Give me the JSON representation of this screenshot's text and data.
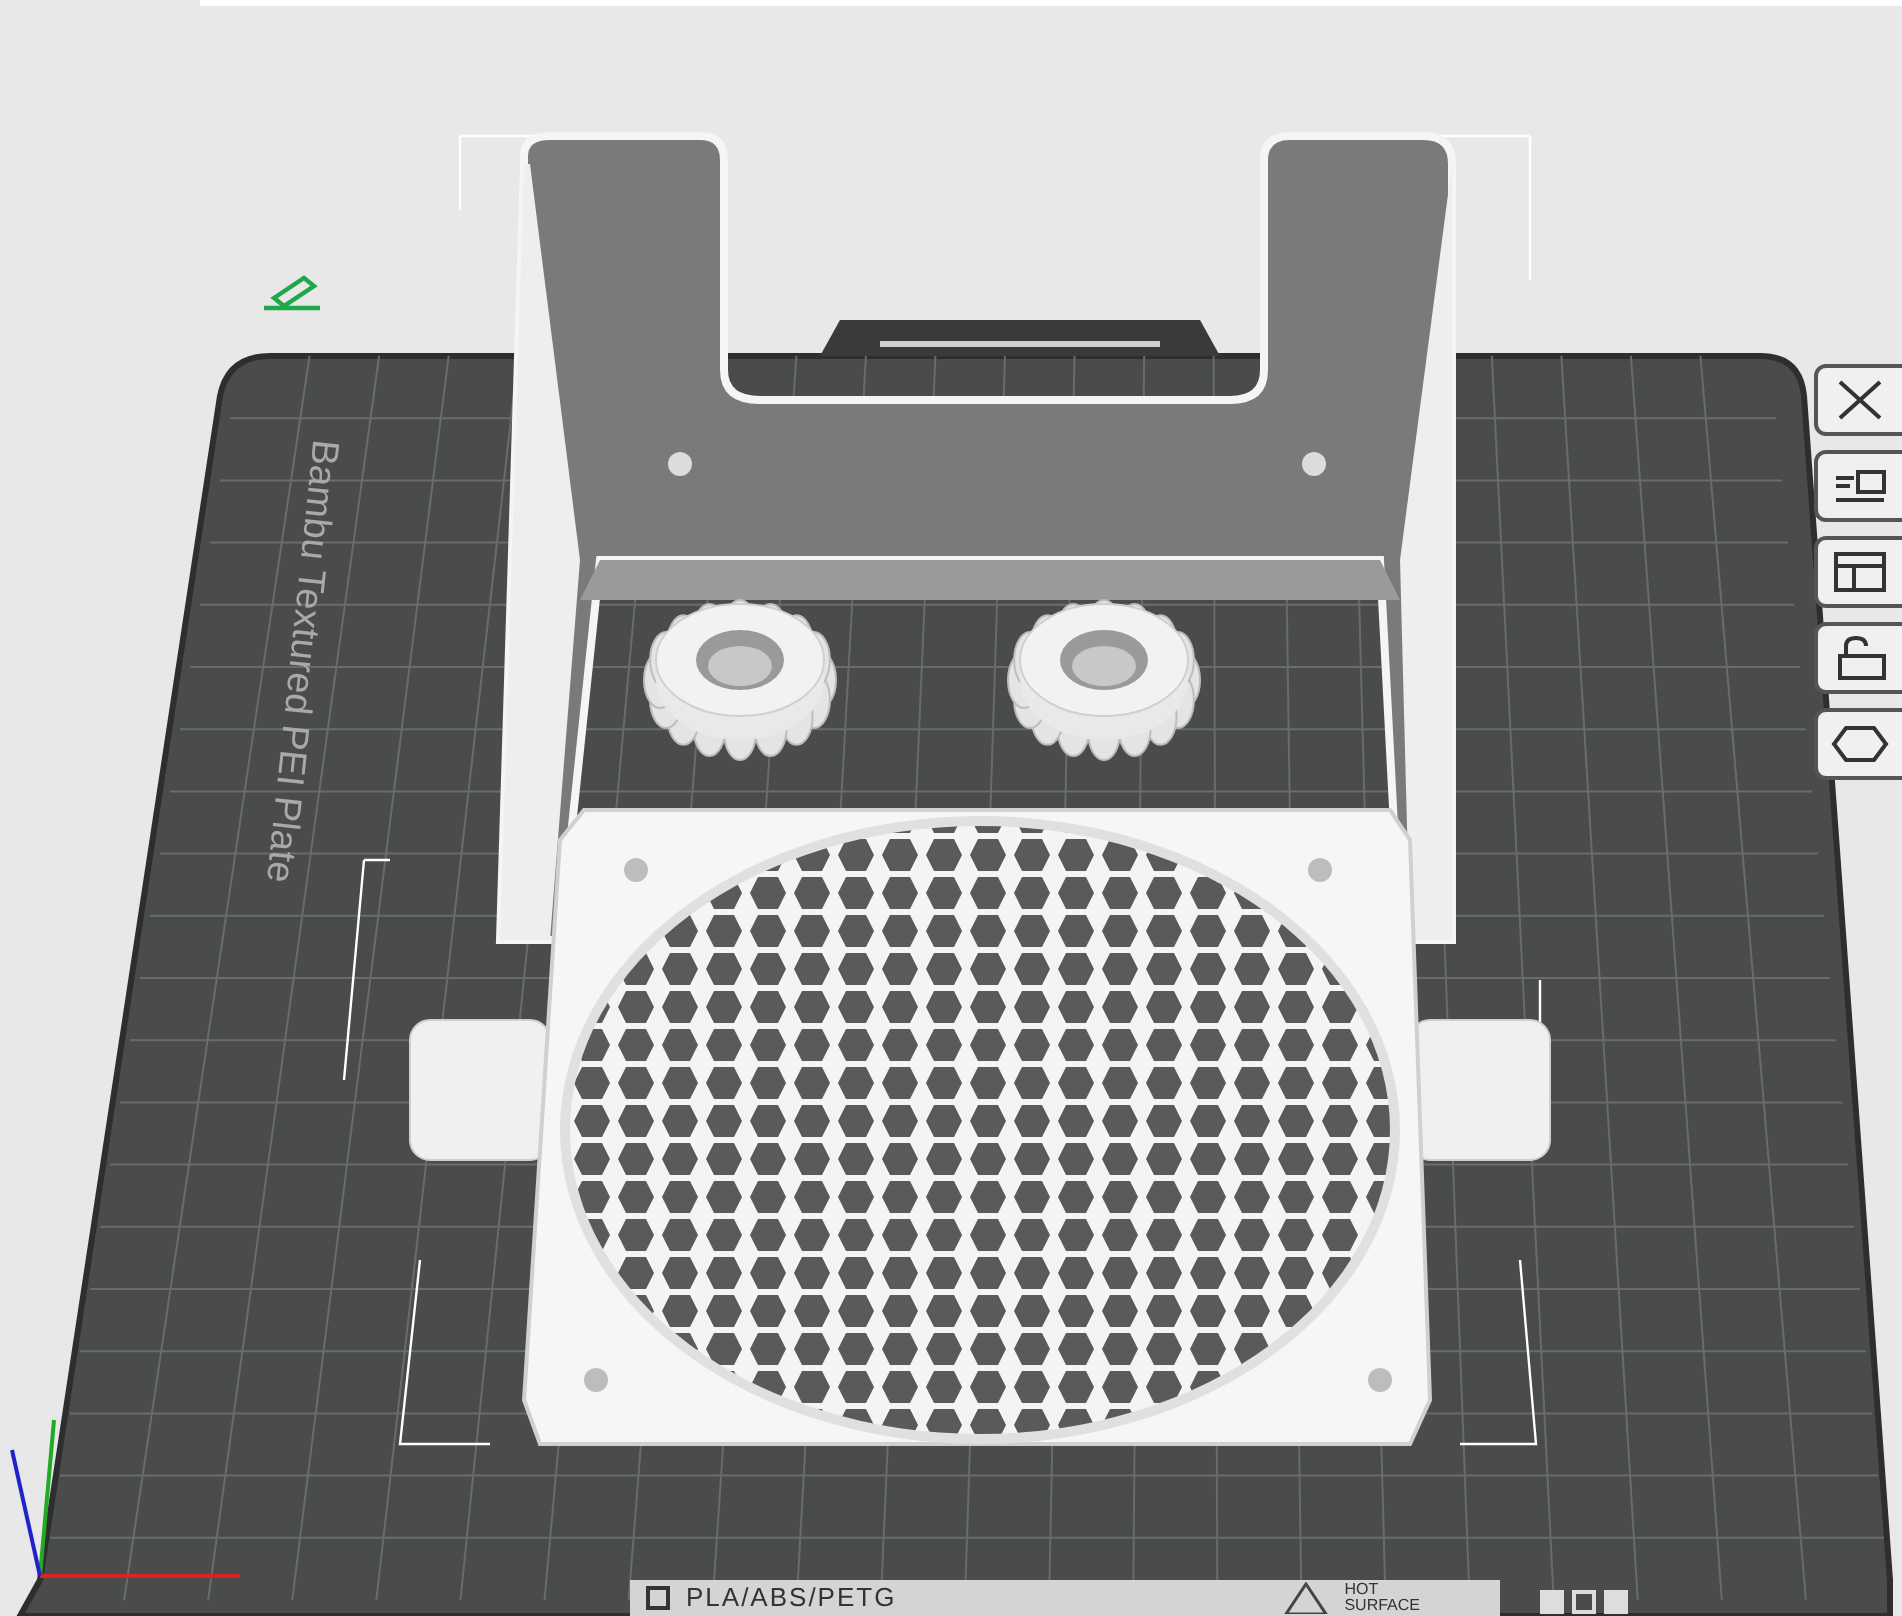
{
  "plate": {
    "label": "Bambu Textured PEI Plate"
  },
  "plate_footer": {
    "material": "PLA/ABS/PETG",
    "warning": [
      "HOT",
      "SURFACE"
    ]
  }
}
